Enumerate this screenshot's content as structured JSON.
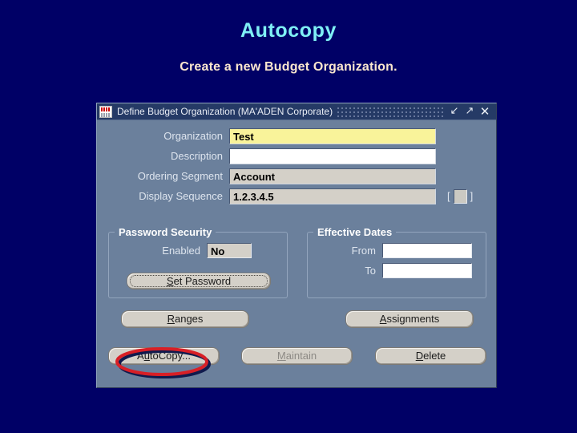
{
  "slide": {
    "title": "Autocopy",
    "subtitle": "Create a new Budget Organization.",
    "background_color": "#000066",
    "title_color": "#7ff0f5",
    "subtitle_color": "#fbe7cf"
  },
  "dialog": {
    "titlebar": {
      "title": "Define Budget Organization (MA'ADEN Corporate)",
      "icon": "oracle-app-icon",
      "buttons": {
        "minimize": "↙",
        "maximize": "↗",
        "close": "✕"
      }
    },
    "background_color": "#6b809c",
    "fields": [
      {
        "label": "Organization",
        "value": "Test",
        "style": "yellow"
      },
      {
        "label": "Description",
        "value": "",
        "style": "white"
      },
      {
        "label": "Ordering Segment",
        "value": "Account",
        "style": "gray"
      },
      {
        "label": "Display Sequence",
        "value": "1.2.3.4.5",
        "style": "gray"
      }
    ],
    "sequence_indicator": {
      "open_bracket": "[",
      "close_bracket": "]"
    },
    "password_security": {
      "legend": "Password Security",
      "enabled_label": "Enabled",
      "enabled_value": "No",
      "set_password_button": {
        "prefix": "",
        "accel": "S",
        "rest": "et Password"
      }
    },
    "effective_dates": {
      "legend": "Effective Dates",
      "from_label": "From",
      "from_value": "",
      "to_label": "To",
      "to_value": ""
    },
    "buttons": {
      "ranges": {
        "prefix": "",
        "accel": "R",
        "rest": "anges",
        "disabled": false
      },
      "assignments": {
        "prefix": "",
        "accel": "A",
        "rest": "ssignments",
        "disabled": false
      },
      "autocopy": {
        "prefix": "A",
        "accel": "u",
        "rest": "toCopy...",
        "disabled": false
      },
      "maintain": {
        "prefix": "",
        "accel": "M",
        "rest": "aintain",
        "disabled": true
      },
      "delete": {
        "prefix": "",
        "accel": "D",
        "rest": "elete",
        "disabled": false
      }
    }
  },
  "annotation": {
    "shape": "ellipse",
    "target": "autocopy-button",
    "color": "#d81f26",
    "shadow_color": "#101a4d"
  }
}
